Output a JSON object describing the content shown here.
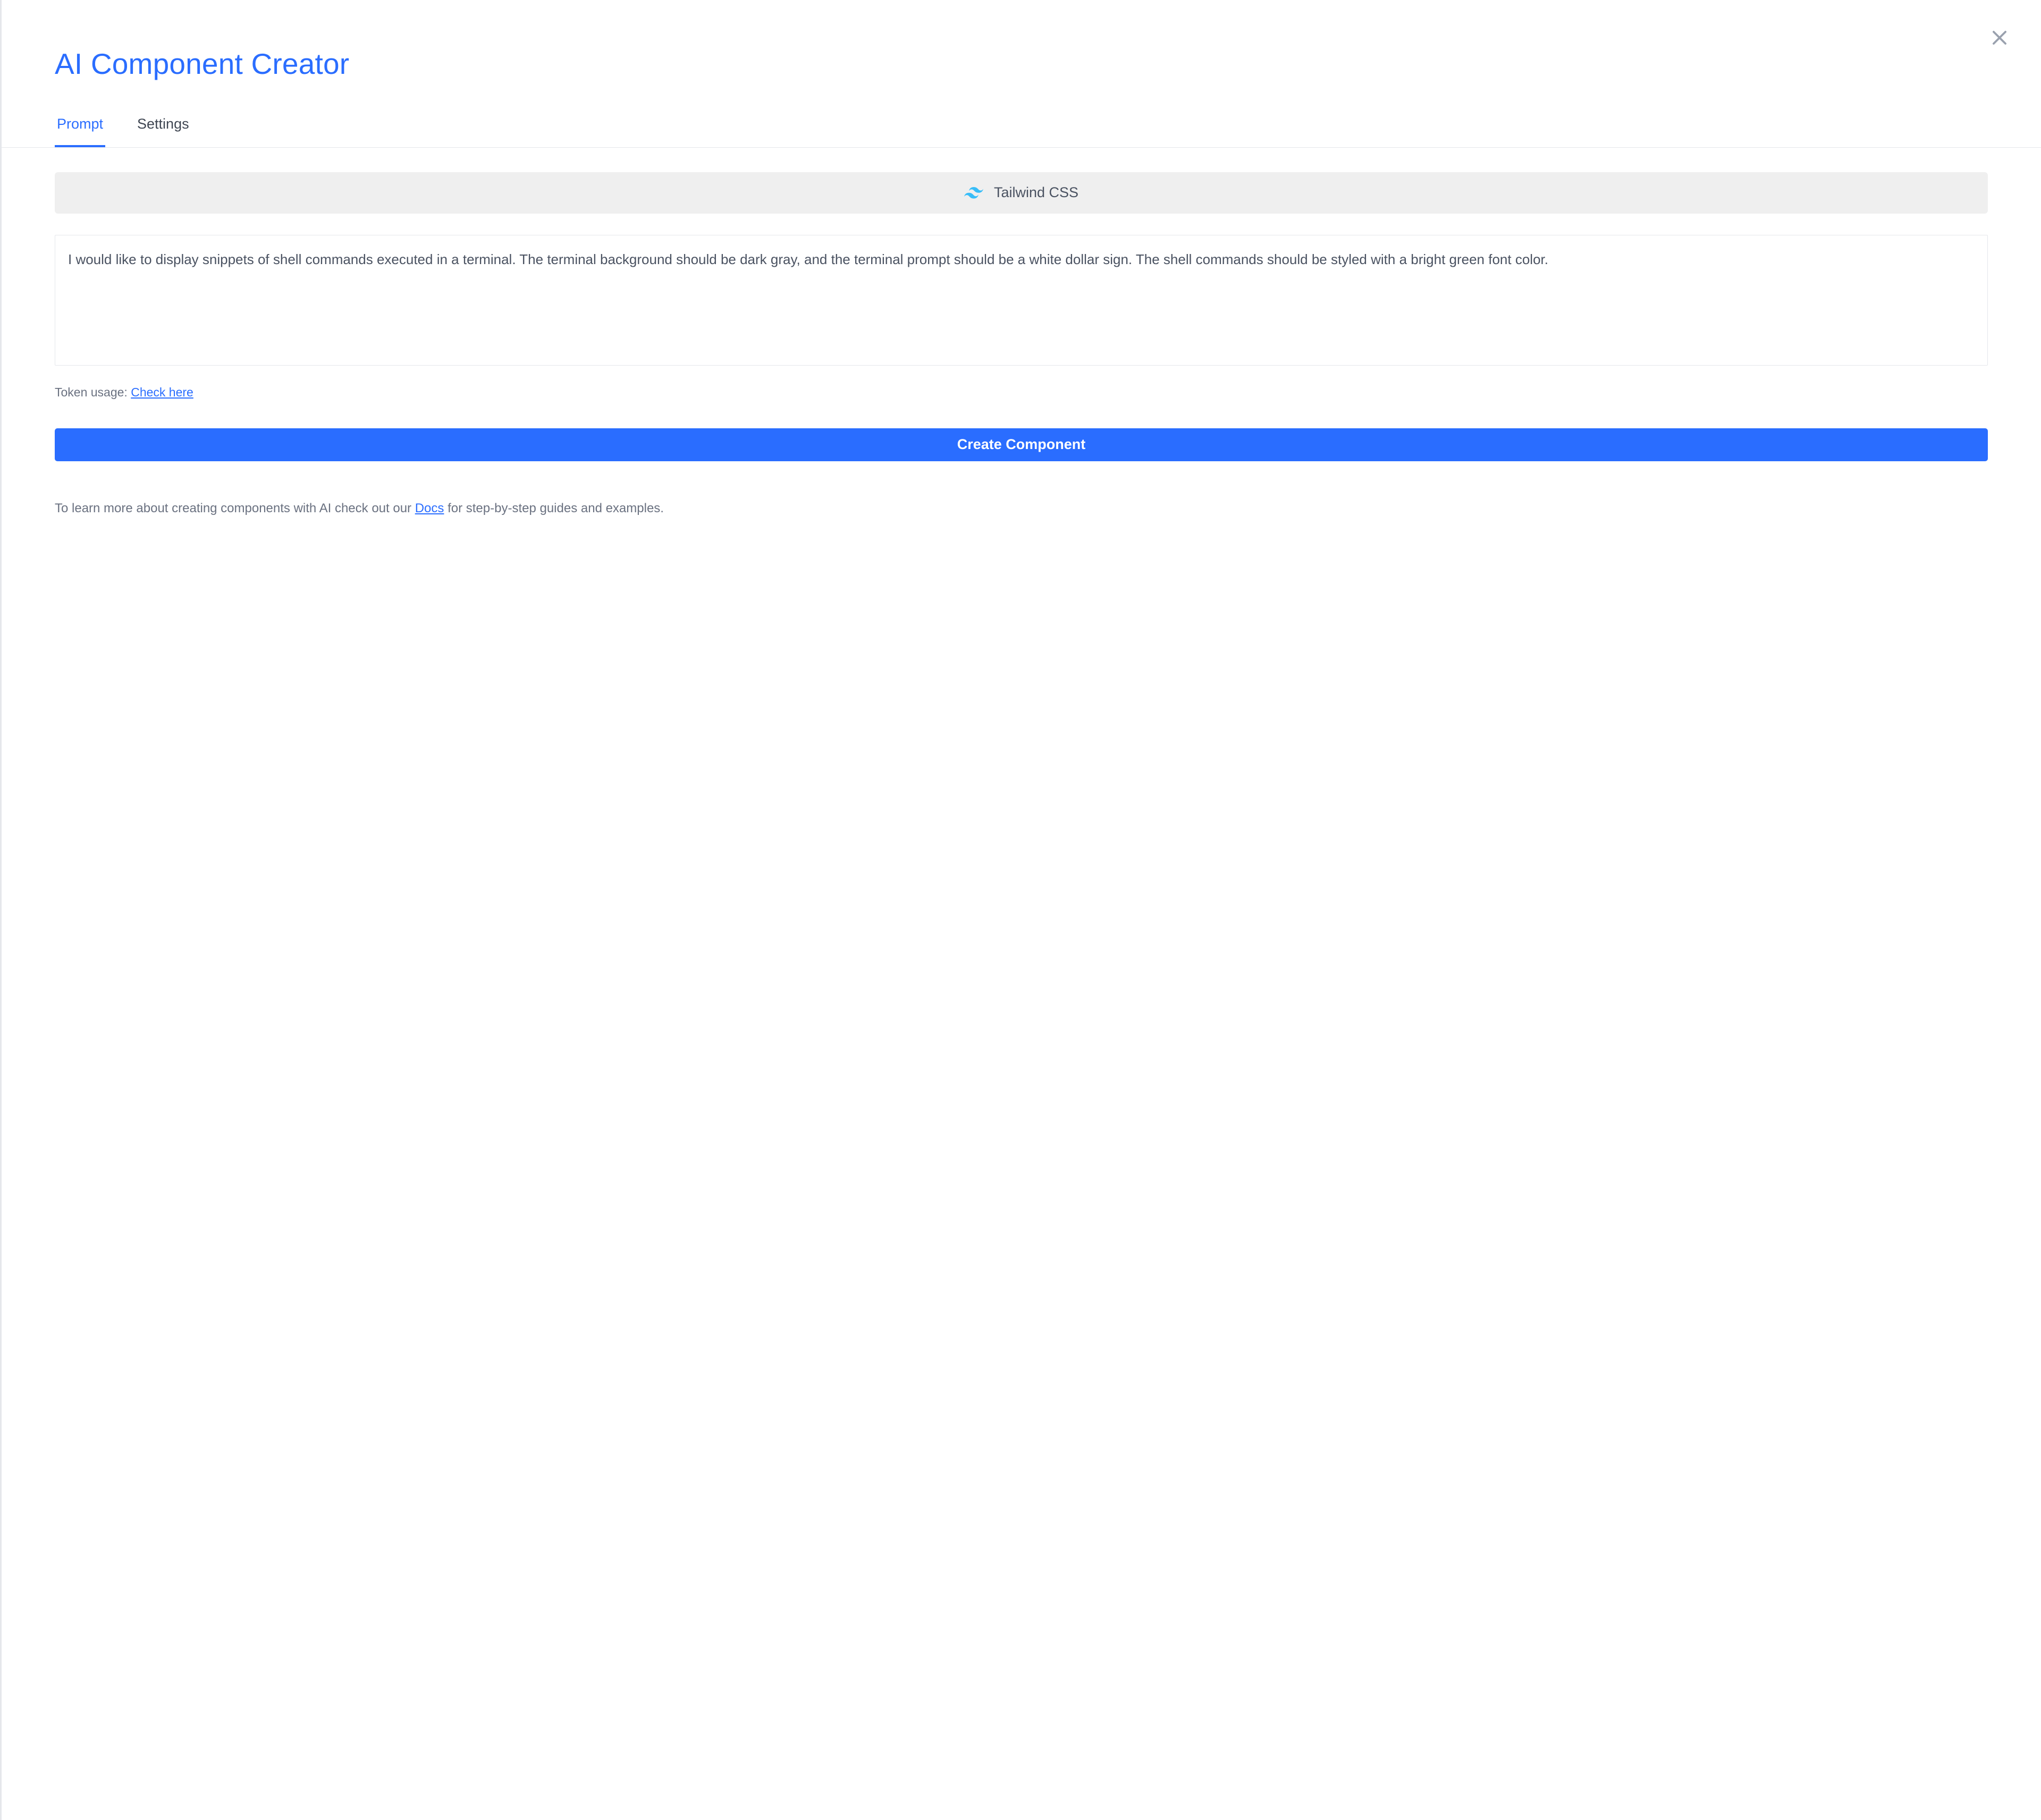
{
  "modal": {
    "title": "AI Component Creator"
  },
  "tabs": {
    "prompt_label": "Prompt",
    "settings_label": "Settings",
    "active": "prompt"
  },
  "framework": {
    "label": "Tailwind CSS"
  },
  "prompt": {
    "value": "I would like to display snippets of shell commands executed in a terminal. The terminal background should be dark gray, and the terminal prompt should be a white dollar sign. The shell commands should be styled with a bright green font color."
  },
  "token": {
    "prefix": "Token usage: ",
    "link_label": "Check here"
  },
  "actions": {
    "create_label": "Create Component"
  },
  "docs": {
    "prefix": "To learn more about creating components with AI check out our ",
    "link_label": "Docs",
    "suffix": " for step-by-step guides and examples."
  },
  "colors": {
    "primary": "#2a6dff",
    "chip_bg": "#efefef",
    "text_muted": "#6a7180",
    "text_body": "#4a5261",
    "border": "#e5e7eb",
    "tailwind_icon": "#38bdf8"
  },
  "icons": {
    "close": "close-icon",
    "tailwind": "tailwind-icon"
  }
}
